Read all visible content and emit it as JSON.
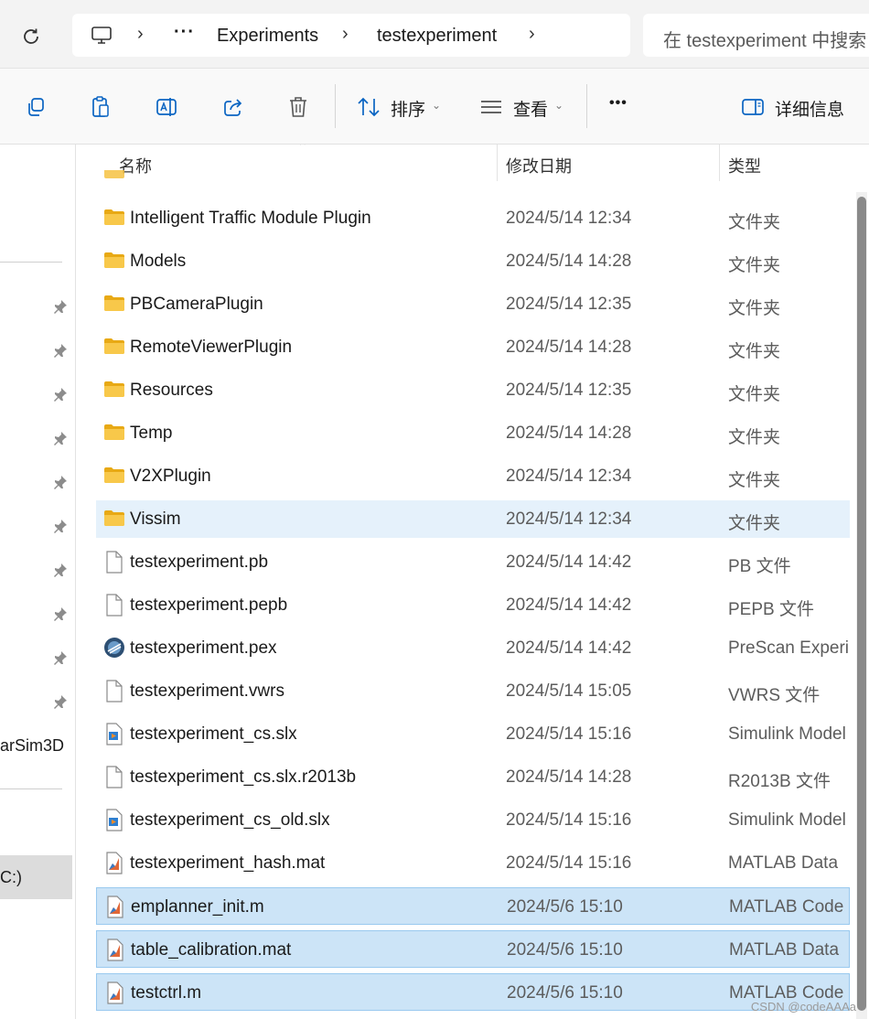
{
  "address": {
    "breadcrumbs": [
      "Experiments",
      "testexperiment"
    ],
    "ellipsis": "···",
    "search_placeholder": "在 testexperiment 中搜索"
  },
  "toolbar": {
    "sort_label": "排序",
    "view_label": "查看",
    "more_label": "•••",
    "details_label": "详细信息"
  },
  "nav": {
    "partial_item": "arSim3D",
    "drive_item": "C:)"
  },
  "columns": {
    "name": "名称",
    "date": "修改日期",
    "type": "类型"
  },
  "files": [
    {
      "name": "Intelligent Traffic Module Plugin",
      "date": "2024/5/14 12:34",
      "type": "文件夹",
      "icon": "folder-icon",
      "state": "normal"
    },
    {
      "name": "Models",
      "date": "2024/5/14 14:28",
      "type": "文件夹",
      "icon": "folder-icon",
      "state": "normal"
    },
    {
      "name": "PBCameraPlugin",
      "date": "2024/5/14 12:35",
      "type": "文件夹",
      "icon": "folder-icon",
      "state": "normal"
    },
    {
      "name": "RemoteViewerPlugin",
      "date": "2024/5/14 14:28",
      "type": "文件夹",
      "icon": "folder-icon",
      "state": "normal"
    },
    {
      "name": "Resources",
      "date": "2024/5/14 12:35",
      "type": "文件夹",
      "icon": "folder-icon",
      "state": "normal"
    },
    {
      "name": "Temp",
      "date": "2024/5/14 14:28",
      "type": "文件夹",
      "icon": "folder-icon",
      "state": "normal"
    },
    {
      "name": "V2XPlugin",
      "date": "2024/5/14 12:34",
      "type": "文件夹",
      "icon": "folder-icon",
      "state": "normal"
    },
    {
      "name": "Vissim",
      "date": "2024/5/14 12:34",
      "type": "文件夹",
      "icon": "folder-icon",
      "state": "hover"
    },
    {
      "name": "testexperiment.pb",
      "date": "2024/5/14 14:42",
      "type": "PB 文件",
      "icon": "file-icon",
      "state": "normal"
    },
    {
      "name": "testexperiment.pepb",
      "date": "2024/5/14 14:42",
      "type": "PEPB 文件",
      "icon": "file-icon",
      "state": "normal"
    },
    {
      "name": "testexperiment.pex",
      "date": "2024/5/14 14:42",
      "type": "PreScan Experim",
      "icon": "prescan-icon",
      "state": "normal"
    },
    {
      "name": "testexperiment.vwrs",
      "date": "2024/5/14 15:05",
      "type": "VWRS 文件",
      "icon": "file-icon",
      "state": "normal"
    },
    {
      "name": "testexperiment_cs.slx",
      "date": "2024/5/14 15:16",
      "type": "Simulink Model",
      "icon": "simulink-icon",
      "state": "normal"
    },
    {
      "name": "testexperiment_cs.slx.r2013b",
      "date": "2024/5/14 14:28",
      "type": "R2013B 文件",
      "icon": "file-icon",
      "state": "normal"
    },
    {
      "name": "testexperiment_cs_old.slx",
      "date": "2024/5/14 15:16",
      "type": "Simulink Model",
      "icon": "simulink-icon",
      "state": "normal"
    },
    {
      "name": "testexperiment_hash.mat",
      "date": "2024/5/14 15:16",
      "type": "MATLAB Data",
      "icon": "matlab-icon",
      "state": "normal"
    },
    {
      "name": "emplanner_init.m",
      "date": "2024/5/6 15:10",
      "type": "MATLAB Code",
      "icon": "matlab-icon",
      "state": "selected"
    },
    {
      "name": "table_calibration.mat",
      "date": "2024/5/6 15:10",
      "type": "MATLAB Data",
      "icon": "matlab-icon",
      "state": "selected"
    },
    {
      "name": "testctrl.m",
      "date": "2024/5/6 15:10",
      "type": "MATLAB Code",
      "icon": "matlab-icon",
      "state": "selected"
    }
  ],
  "watermark": "CSDN @codeAAAa"
}
